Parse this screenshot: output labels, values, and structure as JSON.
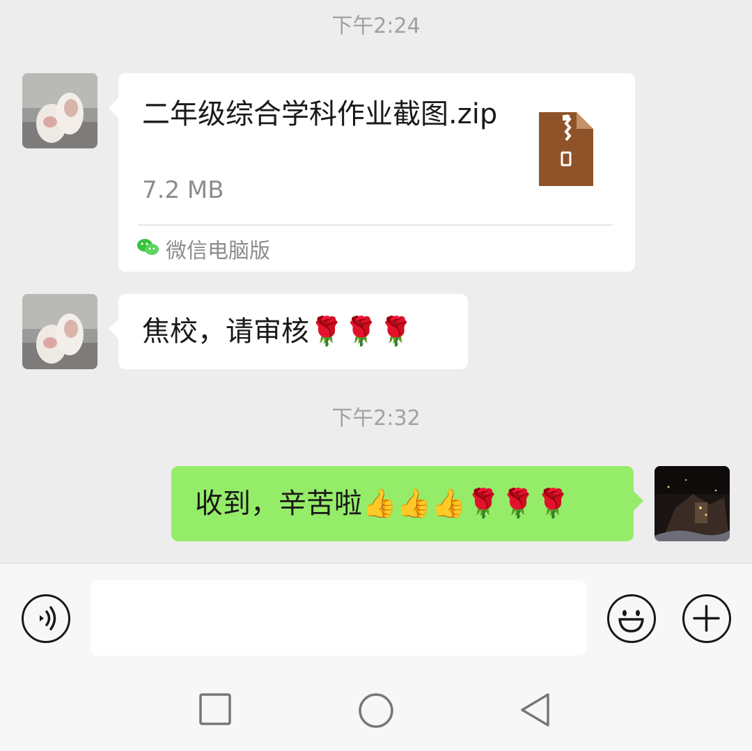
{
  "messages": {
    "time1": "下午2:24",
    "file": {
      "name": "二年级综合学科作业截图.zip",
      "size": "7.2 MB",
      "source": "微信电脑版",
      "icon": "zip-file-icon"
    },
    "text1": "焦校，请审核🌹🌹🌹",
    "time2": "下午2:32",
    "text2": "收到，辛苦啦👍👍👍🌹🌹🌹"
  },
  "input": {
    "value": "",
    "voice_icon": "voice-icon",
    "emoji_icon": "emoji-icon",
    "plus_icon": "plus-icon"
  },
  "nav": {
    "recent_icon": "square-icon",
    "home_icon": "circle-icon",
    "back_icon": "triangle-back-icon"
  },
  "colors": {
    "background": "#ededed",
    "my_bubble": "#95ec69",
    "other_bubble": "#ffffff",
    "zip_icon": "#8e5328"
  }
}
